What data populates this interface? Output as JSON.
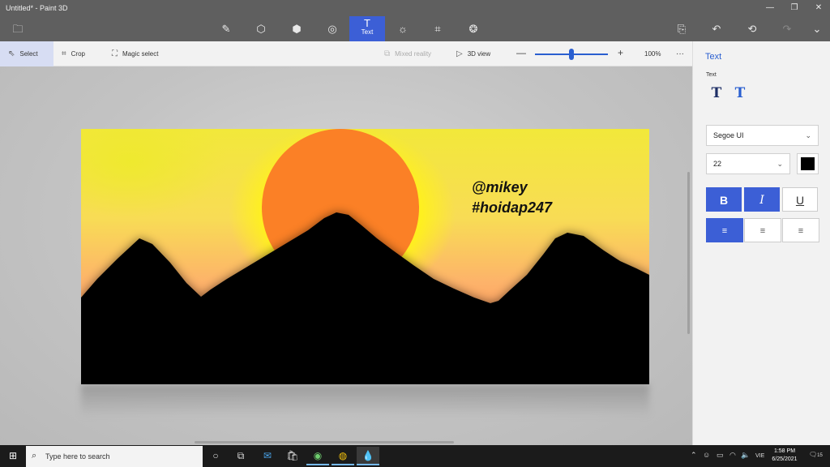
{
  "window": {
    "title": "Untitled* - Paint 3D"
  },
  "toolbar": {
    "tools": [
      {
        "name": "menu",
        "glyph": "🗀"
      },
      {
        "name": "brushes",
        "glyph": "✎"
      },
      {
        "name": "2d-shapes",
        "glyph": "⬡"
      },
      {
        "name": "3d-shapes",
        "glyph": "⬢"
      },
      {
        "name": "stickers",
        "glyph": "◎"
      },
      {
        "name": "text",
        "glyph": "T",
        "label": "Text",
        "active": true
      },
      {
        "name": "effects",
        "glyph": "☼"
      },
      {
        "name": "canvas",
        "glyph": "⌗"
      },
      {
        "name": "3d-library",
        "glyph": "❂"
      }
    ],
    "right": [
      "paste",
      "undo",
      "history",
      "redo",
      "expand"
    ]
  },
  "subbar": {
    "select": "Select",
    "crop": "Crop",
    "magic_select": "Magic select",
    "mixed_reality": "Mixed reality",
    "view_3d": "3D view",
    "zoom_value": "100%",
    "zoom_fraction": 0.5
  },
  "canvas": {
    "line1": "@mikey",
    "line2": "#hoidap247"
  },
  "panel": {
    "title": "Text",
    "section": "Text",
    "font": "Segoe UI",
    "size": "22",
    "text_color": "#000000",
    "bold": "B",
    "italic": "I",
    "underline": "U"
  },
  "taskbar": {
    "search_placeholder": "Type here to search",
    "language": "VIE",
    "time": "1:58 PM",
    "date": "6/25/2021",
    "notifications": "15"
  },
  "colors": {
    "accent": "#3c5fd6",
    "titlebar": "#5f5f5f"
  }
}
